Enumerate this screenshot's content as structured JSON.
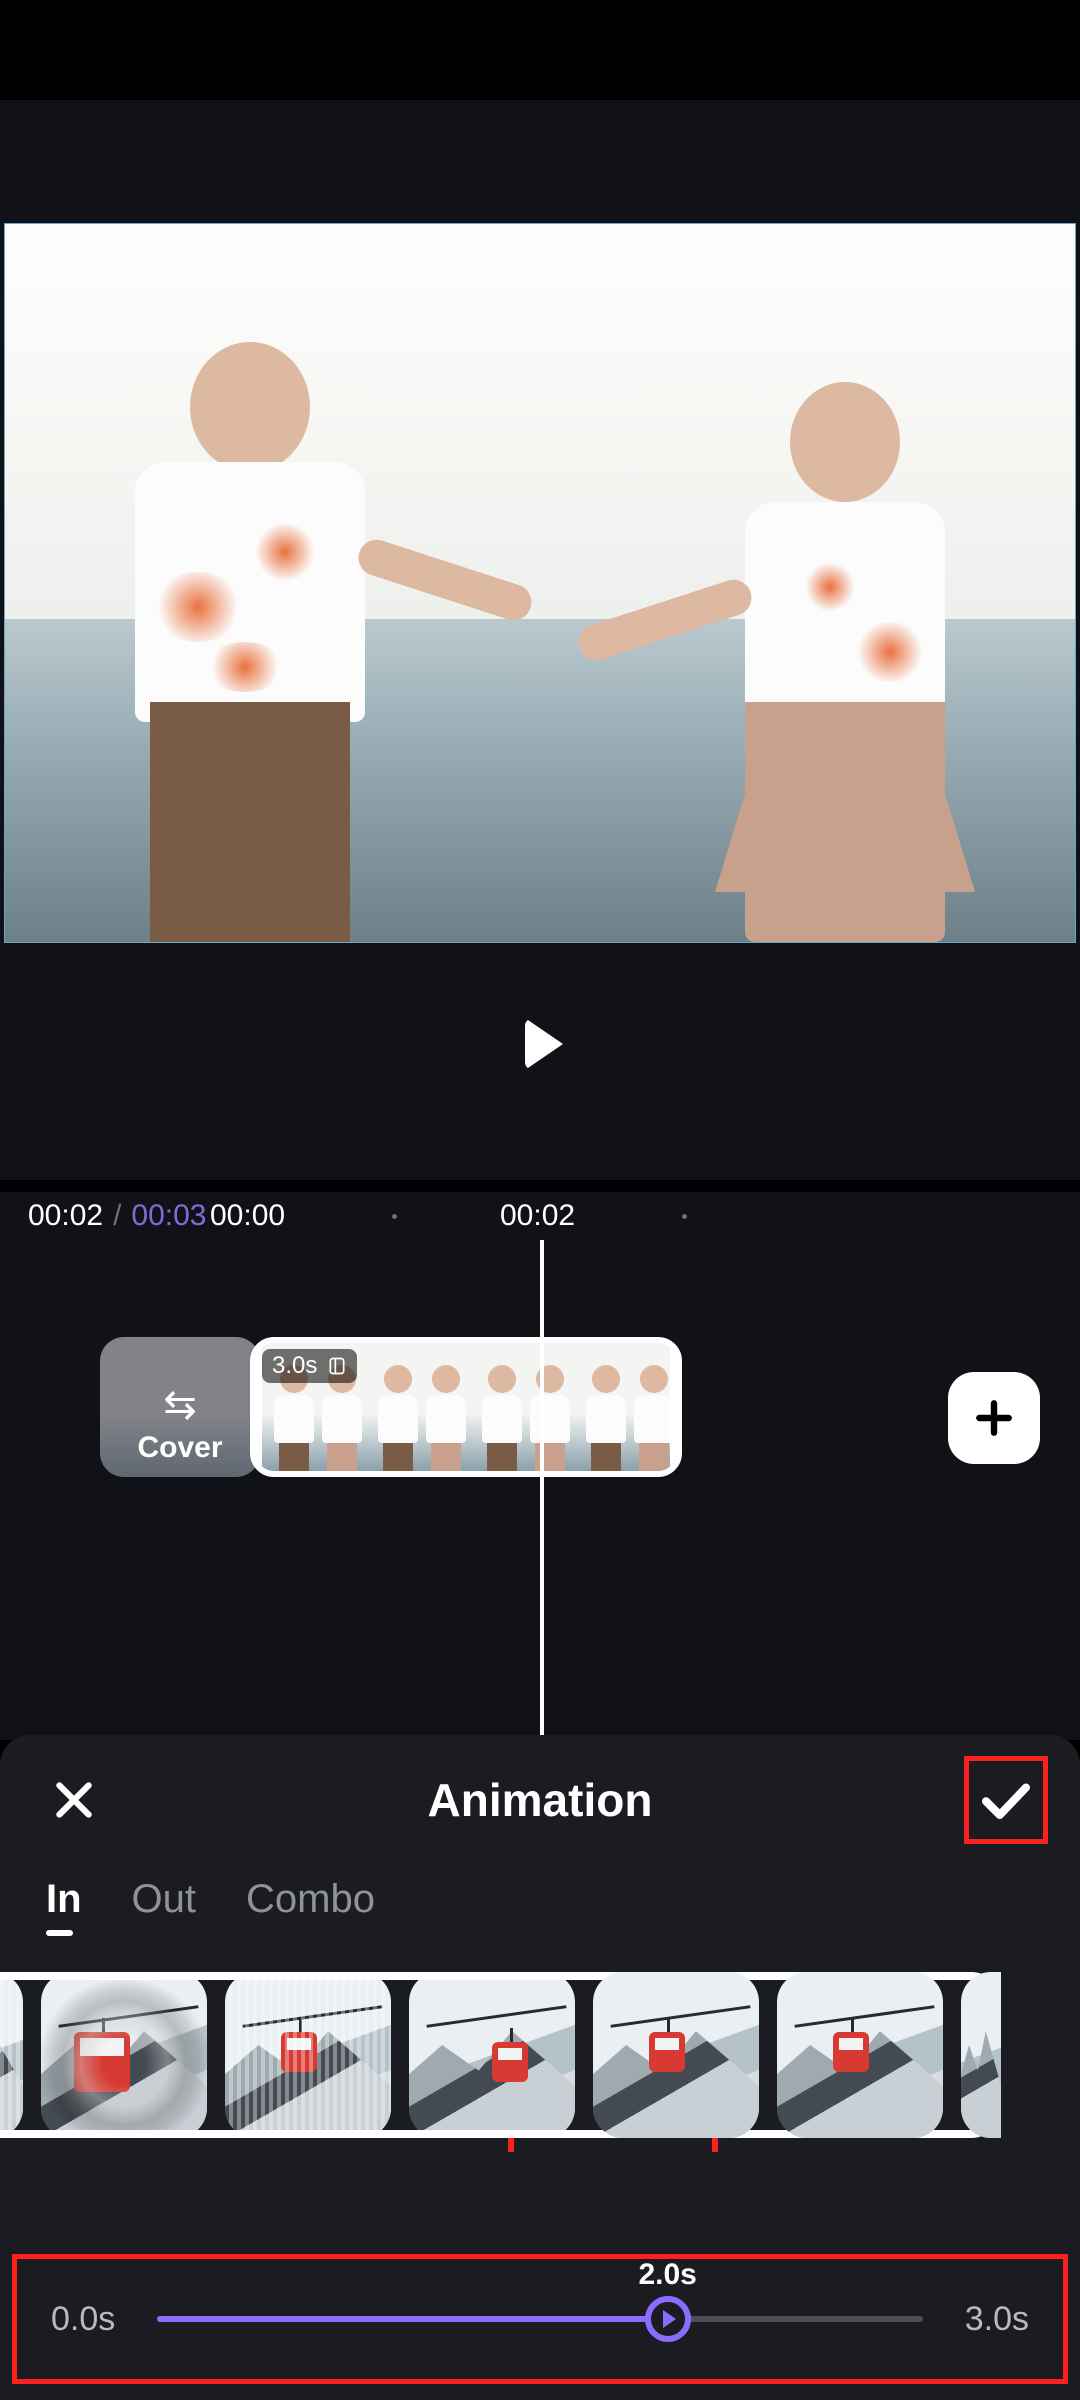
{
  "preview": {
    "play_label": "play"
  },
  "time": {
    "current": "00:02",
    "separator": "/",
    "duration": "00:03",
    "ticks": [
      "00:00",
      "00:02"
    ]
  },
  "timeline": {
    "cover_label": "Cover",
    "clip_duration": "3.0s",
    "add_label": "add-clip"
  },
  "panel": {
    "title": "Animation",
    "tabs": [
      {
        "id": "in",
        "label": "In",
        "active": true
      },
      {
        "id": "out",
        "label": "Out",
        "active": false
      },
      {
        "id": "combo",
        "label": "Combo",
        "active": false
      }
    ],
    "selected_index": 3,
    "slider": {
      "min_label": "0.0s",
      "max_label": "3.0s",
      "value_label": "2.0s",
      "min": 0.0,
      "max": 3.0,
      "value": 2.0
    }
  }
}
